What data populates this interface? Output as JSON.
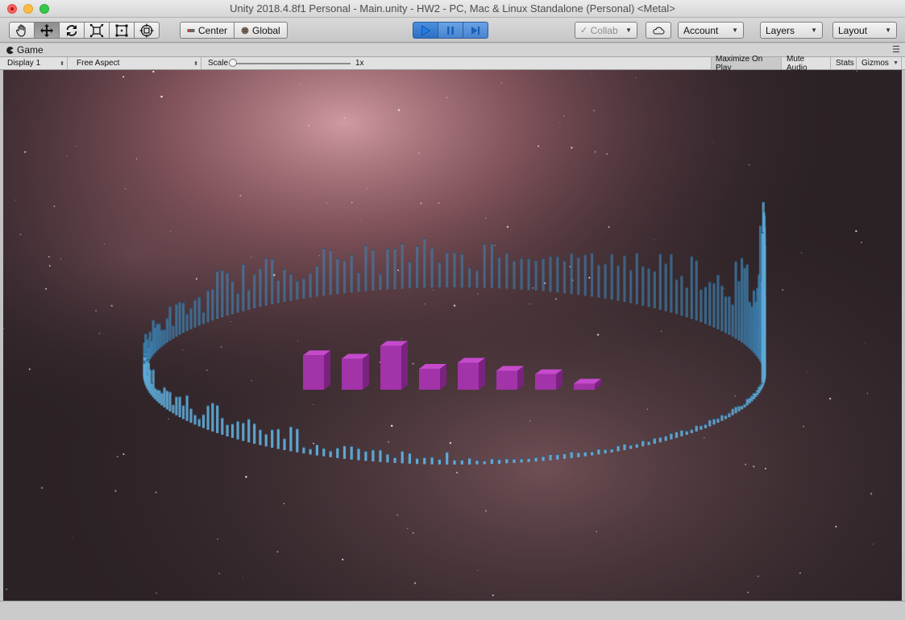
{
  "window": {
    "title": "Unity 2018.4.8f1 Personal - Main.unity - HW2 - PC, Mac & Linux Standalone (Personal) <Metal>"
  },
  "toolbar": {
    "tools": [
      {
        "name": "hand-tool-icon"
      },
      {
        "name": "move-tool-icon"
      },
      {
        "name": "rotate-tool-icon"
      },
      {
        "name": "scale-tool-icon"
      },
      {
        "name": "rect-tool-icon"
      },
      {
        "name": "transform-tool-icon"
      }
    ],
    "active_tool": "move-tool-icon",
    "pivot_label": "Center",
    "space_label": "Global",
    "collab_label": "Collab",
    "account_label": "Account",
    "layers_label": "Layers",
    "layout_label": "Layout",
    "play_state": "playing"
  },
  "tab": {
    "label": "Game"
  },
  "gamebar": {
    "display": "Display 1",
    "aspect": "Free Aspect",
    "scale_label": "Scale",
    "scale_value": "1x",
    "maximize_on_play": "Maximize On Play",
    "mute_audio": "Mute Audio",
    "stats": "Stats",
    "gizmos": "Gizmos"
  },
  "scene": {
    "ring_color": "#3d86b8",
    "ring_dark": "#24557a",
    "ring_light": "#5ea9d6",
    "bar_color": "#a333a8",
    "bar_top": "#c64bcc",
    "bar_dark": "#7a2280",
    "bands": [
      0.69,
      0.62,
      0.88,
      0.42,
      0.54,
      0.38,
      0.31,
      0.12
    ],
    "space_colors": {
      "nebula": "#b4737c",
      "deep": "#221a1e"
    }
  }
}
